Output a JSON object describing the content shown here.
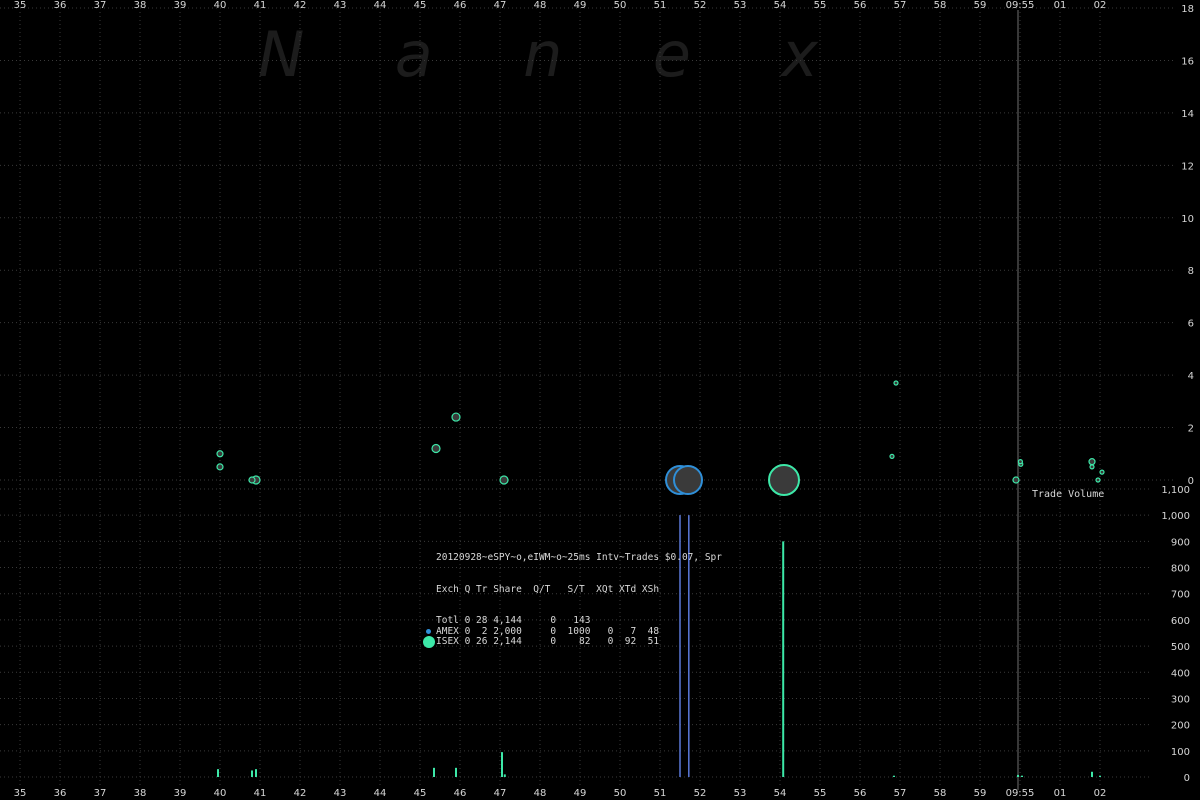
{
  "watermark": "N a n e x",
  "stats": {
    "title": "20120928~eSPY~o,eIWM~o~25ms Intv~Trades $0.07, Spr",
    "header": "Exch Q Tr Share  Q/T   S/T  XQt XTd XSh",
    "rows": [
      {
        "text": "Totl 0 28 4,144     0   143",
        "marker": ""
      },
      {
        "text": "AMEX 0  2 2,000     0  1000   0   7  48",
        "marker": "small-blue"
      },
      {
        "text": "ISEX 0 26 2,144     0    82   0  92  51",
        "marker": "large-teal"
      }
    ]
  },
  "trade_volume_label": "Trade Volume",
  "colors": {
    "amex": "#2f8fd8",
    "isex": "#3de8a8",
    "grid": "#3a3a3a",
    "text": "#d6d6d6",
    "bar_blue": "#5a78d8"
  },
  "chart_data": {
    "type": "scatter",
    "x_tick_labels": [
      "35",
      "36",
      "37",
      "38",
      "39",
      "40",
      "41",
      "42",
      "43",
      "44",
      "45",
      "46",
      "47",
      "48",
      "49",
      "50",
      "51",
      "52",
      "53",
      "54",
      "55",
      "56",
      "57",
      "58",
      "59",
      "09:55",
      "01",
      "02"
    ],
    "price_panel": {
      "y_ticks": [
        "0",
        "2",
        "4",
        "6",
        "8",
        "10",
        "12",
        "14",
        "16",
        "18"
      ],
      "ylim": [
        0,
        18
      ],
      "points": [
        {
          "x": 40.0,
          "y": 1.0,
          "size": 3,
          "exch": "ISEX"
        },
        {
          "x": 40.0,
          "y": 0.5,
          "size": 3,
          "exch": "ISEX"
        },
        {
          "x": 40.9,
          "y": 0.0,
          "size": 4,
          "exch": "ISEX"
        },
        {
          "x": 40.8,
          "y": 0.0,
          "size": 3,
          "exch": "ISEX"
        },
        {
          "x": 45.4,
          "y": 1.2,
          "size": 4,
          "exch": "ISEX"
        },
        {
          "x": 45.9,
          "y": 2.4,
          "size": 4,
          "exch": "ISEX"
        },
        {
          "x": 47.1,
          "y": 0.0,
          "size": 4,
          "exch": "ISEX"
        },
        {
          "x": 51.5,
          "y": 0.0,
          "size": 14,
          "exch": "AMEX"
        },
        {
          "x": 51.7,
          "y": 0.0,
          "size": 14,
          "exch": "AMEX"
        },
        {
          "x": 54.1,
          "y": 0.0,
          "size": 15,
          "exch": "ISEX"
        },
        {
          "x": 56.9,
          "y": 3.7,
          "size": 2,
          "exch": "ISEX"
        },
        {
          "x": 56.8,
          "y": 0.9,
          "size": 2,
          "exch": "ISEX"
        },
        {
          "x": 59.9,
          "y": 0.0,
          "size": 3,
          "exch": "ISEX"
        },
        {
          "x": 60.02,
          "y": 0.6,
          "size": 2,
          "exch": "ISEX"
        },
        {
          "x": 60.01,
          "y": 0.7,
          "size": 2,
          "exch": "ISEX"
        },
        {
          "x": 61.8,
          "y": 0.7,
          "size": 3,
          "exch": "ISEX"
        },
        {
          "x": 61.8,
          "y": 0.5,
          "size": 2,
          "exch": "ISEX"
        },
        {
          "x": 62.05,
          "y": 0.3,
          "size": 2,
          "exch": "ISEX"
        },
        {
          "x": 61.95,
          "y": 0.0,
          "size": 2,
          "exch": "ISEX"
        }
      ]
    },
    "volume_panel": {
      "y_ticks": [
        "0",
        "100",
        "200",
        "300",
        "400",
        "500",
        "600",
        "700",
        "800",
        "900",
        "1,000",
        "1,100"
      ],
      "ylim": [
        0,
        1100
      ],
      "bars": [
        {
          "x": 39.95,
          "value": 30,
          "exch": "ISEX"
        },
        {
          "x": 40.8,
          "value": 25,
          "exch": "ISEX"
        },
        {
          "x": 40.9,
          "value": 30,
          "exch": "ISEX"
        },
        {
          "x": 45.35,
          "value": 35,
          "exch": "ISEX"
        },
        {
          "x": 45.9,
          "value": 35,
          "exch": "ISEX"
        },
        {
          "x": 47.05,
          "value": 95,
          "exch": "ISEX"
        },
        {
          "x": 47.12,
          "value": 10,
          "exch": "ISEX"
        },
        {
          "x": 51.5,
          "value": 1000,
          "exch": "AMEX"
        },
        {
          "x": 51.72,
          "value": 1000,
          "exch": "AMEX"
        },
        {
          "x": 54.08,
          "value": 900,
          "exch": "ISEX"
        },
        {
          "x": 56.85,
          "value": 5,
          "exch": "ISEX"
        },
        {
          "x": 59.95,
          "value": 8,
          "exch": "ISEX"
        },
        {
          "x": 60.05,
          "value": 5,
          "exch": "ISEX"
        },
        {
          "x": 61.8,
          "value": 20,
          "exch": "ISEX"
        },
        {
          "x": 62.0,
          "value": 5,
          "exch": "ISEX"
        }
      ]
    },
    "vertical_marker_x": 59.95,
    "grid": true
  }
}
